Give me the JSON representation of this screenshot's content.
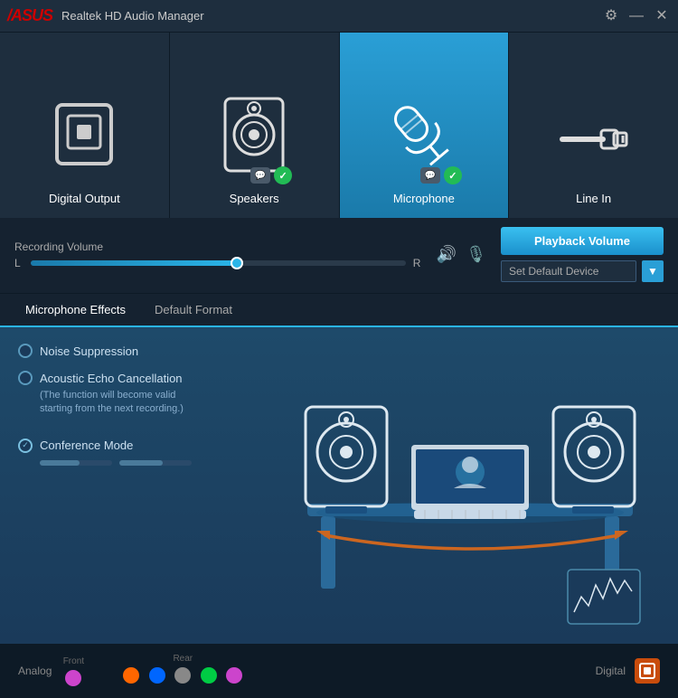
{
  "titleBar": {
    "logo": "/ASUS",
    "title": "Realtek HD Audio Manager",
    "gearBtn": "⚙",
    "minBtn": "—",
    "closeBtn": "✕"
  },
  "deviceTabs": [
    {
      "id": "digital-output",
      "label": "Digital Output",
      "active": false,
      "hasBadges": false
    },
    {
      "id": "speakers",
      "label": "Speakers",
      "active": false,
      "hasBadges": true
    },
    {
      "id": "microphone",
      "label": "Microphone",
      "active": true,
      "hasBadges": true
    },
    {
      "id": "line-in",
      "label": "Line In",
      "active": false,
      "hasBadges": false
    }
  ],
  "volumeSection": {
    "label": "Recording Volume",
    "leftLabel": "L",
    "rightLabel": "R",
    "fillPercent": 55,
    "playbackBtn": "Playback Volume",
    "defaultDeviceLabel": "Set Default Device"
  },
  "tabs": [
    {
      "id": "microphone-effects",
      "label": "Microphone Effects",
      "active": true
    },
    {
      "id": "default-format",
      "label": "Default Format",
      "active": false
    }
  ],
  "effects": [
    {
      "id": "noise-suppression",
      "label": "Noise Suppression",
      "checked": false,
      "sub": ""
    },
    {
      "id": "acoustic-echo",
      "label": "Acoustic Echo Cancellation",
      "checked": false,
      "sub": "(The function will become valid\nstarting from the next recording.)"
    },
    {
      "id": "conference-mode",
      "label": "Conference Mode",
      "checked": true,
      "sub": ""
    }
  ],
  "bottomBar": {
    "analogLabel": "Analog",
    "frontLabel": "Front",
    "rearLabel": "Rear",
    "digitalLabel": "Digital",
    "analogDots": {
      "front": [
        "#cc44cc"
      ],
      "rear": [
        "#ff6600",
        "#0066ff",
        "#888888",
        "#00cc44",
        "#cc44cc"
      ]
    }
  }
}
